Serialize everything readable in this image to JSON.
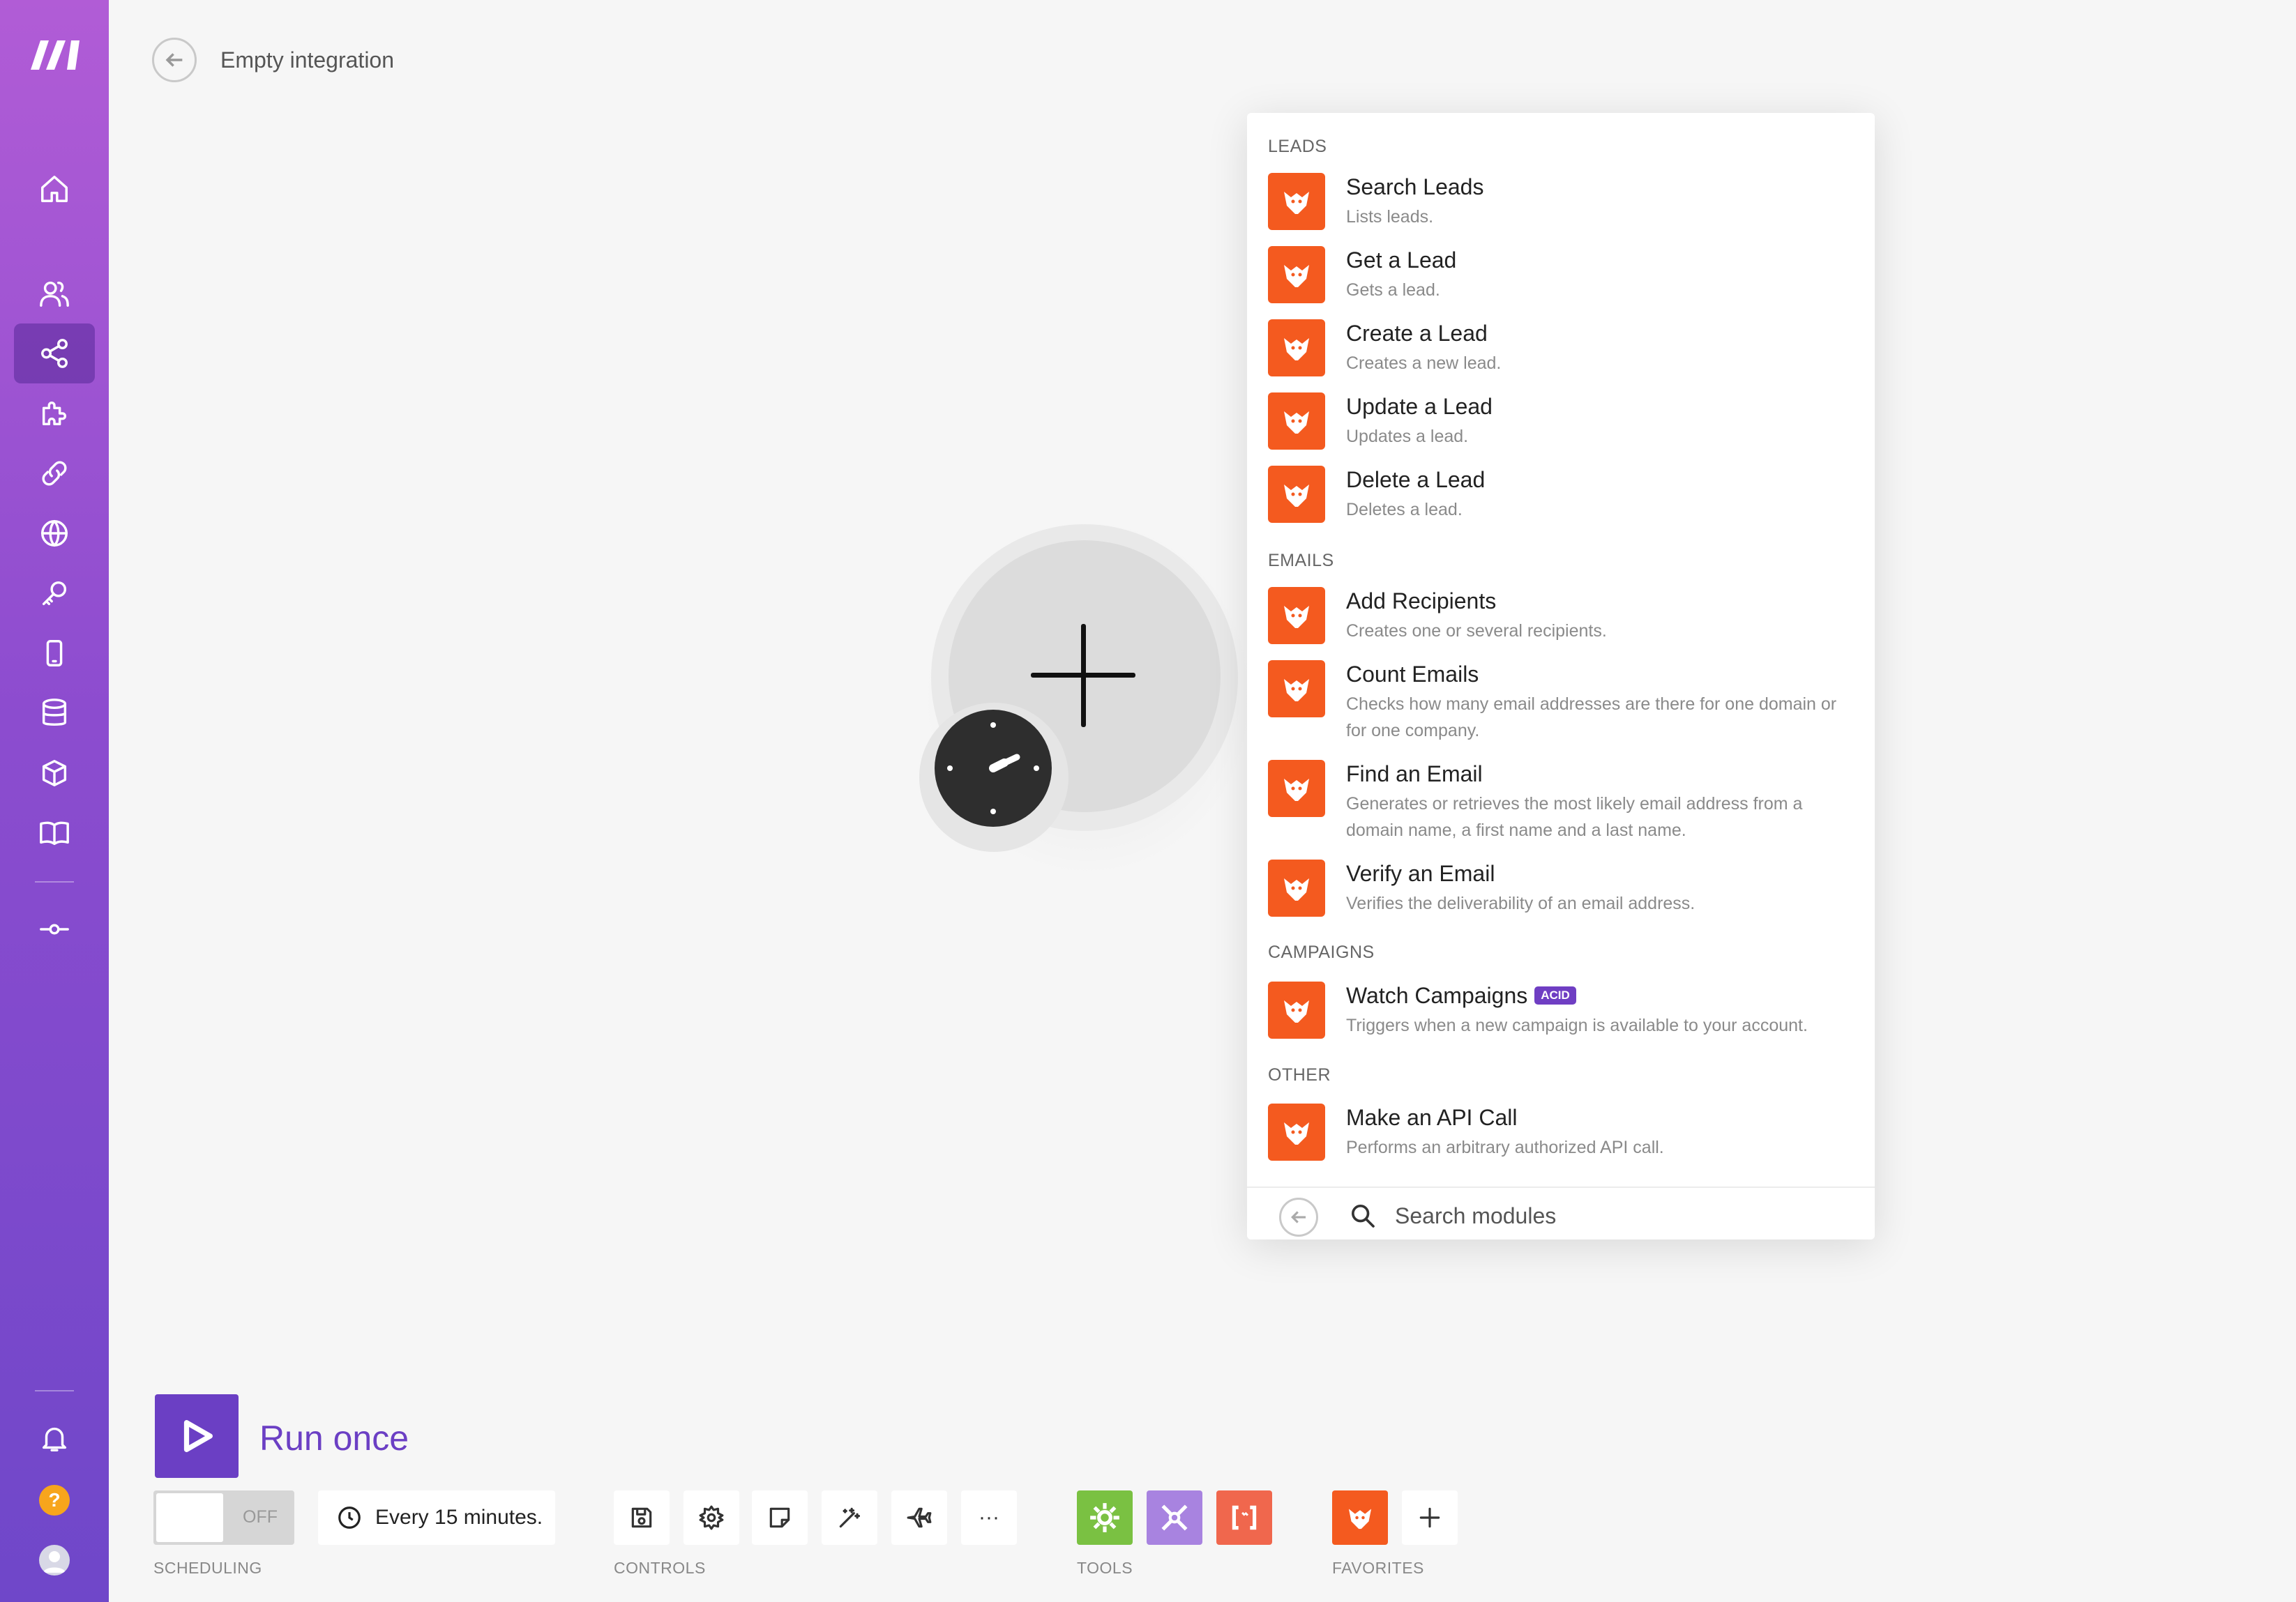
{
  "header": {
    "title": "Empty integration"
  },
  "sidebar": {
    "items": [
      "home-icon",
      "team-icon",
      "scenarios-icon",
      "apps-icon",
      "connections-icon",
      "webhooks-icon",
      "keys-icon",
      "devices-icon",
      "datastores-icon",
      "datastructures-icon",
      "docs-icon",
      "flow-icon"
    ],
    "help_label": "?"
  },
  "panel": {
    "sections": [
      {
        "heading": "LEADS",
        "items": [
          {
            "name": "Search Leads",
            "desc": "Lists leads."
          },
          {
            "name": "Get a Lead",
            "desc": "Gets a lead."
          },
          {
            "name": "Create a Lead",
            "desc": "Creates a new lead."
          },
          {
            "name": "Update a Lead",
            "desc": "Updates a lead."
          },
          {
            "name": "Delete a Lead",
            "desc": "Deletes a lead."
          }
        ]
      },
      {
        "heading": "EMAILS",
        "items": [
          {
            "name": "Add Recipients",
            "desc": "Creates one or several recipients."
          },
          {
            "name": "Count Emails",
            "desc": "Checks how many email addresses are there for one domain or for one company."
          },
          {
            "name": "Find an Email",
            "desc": "Generates or retrieves the most likely email address from a domain name, a first name and a last name."
          },
          {
            "name": "Verify an Email",
            "desc": "Verifies the deliverability of an email address."
          }
        ]
      },
      {
        "heading": "CAMPAIGNS",
        "items": [
          {
            "name": "Watch Campaigns",
            "desc": "Triggers when a new campaign is available to your account.",
            "badge": "ACID"
          }
        ]
      },
      {
        "heading": "OTHER",
        "items": [
          {
            "name": "Make an API Call",
            "desc": "Performs an arbitrary authorized API call."
          }
        ]
      }
    ],
    "search": {
      "placeholder": "Search modules"
    }
  },
  "toolbar": {
    "run_label": "Run once",
    "toggle_label": "OFF",
    "schedule_text": "Every 15 minutes.",
    "labels": {
      "scheduling": "SCHEDULING",
      "controls": "CONTROLS",
      "tools": "TOOLS",
      "favorites": "FAVORITES"
    },
    "more_label": "···"
  },
  "colors": {
    "accent": "#6b3fc4",
    "app": "#f45a1f",
    "tools_green": "#7ac142",
    "tools_purple": "#a883e0",
    "tools_red": "#f0674d",
    "help": "#f7a51c"
  }
}
